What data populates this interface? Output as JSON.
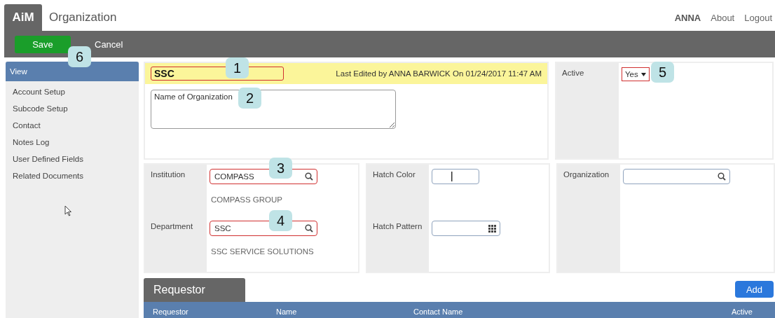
{
  "header": {
    "logo": "AiM",
    "title": "Organization",
    "user": "ANNA",
    "links": [
      "About",
      "Logout"
    ]
  },
  "toolbar": {
    "buttons": [
      {
        "label": "Save",
        "kind": "primary"
      },
      {
        "label": "Cancel",
        "kind": "plain"
      }
    ]
  },
  "sidebar": {
    "items": [
      {
        "label": "View",
        "selected": true
      },
      {
        "label": "Account Setup",
        "selected": false
      },
      {
        "label": "Subcode Setup",
        "selected": false
      },
      {
        "label": "Contact",
        "selected": false
      },
      {
        "label": "Notes Log",
        "selected": false
      },
      {
        "label": "User Defined Fields",
        "selected": false
      },
      {
        "label": "Related Documents",
        "selected": false
      }
    ]
  },
  "record": {
    "code": "SSC",
    "code_highlighted": true,
    "last_edited": "Last Edited by ANNA BARWICK On 01/24/2017 11:47 AM",
    "description": "Name of Organization"
  },
  "status": {
    "label": "Active",
    "value": "Yes",
    "highlighted": true
  },
  "panels": [
    {
      "fields": [
        {
          "label": "Institution",
          "kind": "lookup",
          "value": "COMPASS",
          "highlighted": true,
          "caption": "COMPASS GROUP"
        },
        {
          "label": "Department",
          "kind": "lookup",
          "value": "SSC",
          "highlighted": true,
          "caption": "SSC SERVICE SOLUTIONS"
        }
      ]
    },
    {
      "fields": [
        {
          "label": "Hatch Color",
          "kind": "color",
          "highlighted": false
        },
        {
          "label": "Hatch Pattern",
          "kind": "pattern",
          "highlighted": false
        }
      ]
    },
    {
      "fields": [
        {
          "label": "Organization",
          "kind": "lookup",
          "highlighted": false
        }
      ]
    }
  ],
  "requestor": {
    "title": "Requestor",
    "add_button": "Add",
    "columns": [
      "Requestor",
      "Name",
      "Contact Name",
      "Active"
    ]
  },
  "callouts": [
    {
      "label": "1"
    },
    {
      "label": "2"
    },
    {
      "label": "3"
    },
    {
      "label": "4"
    },
    {
      "label": "5"
    },
    {
      "label": "6"
    }
  ]
}
